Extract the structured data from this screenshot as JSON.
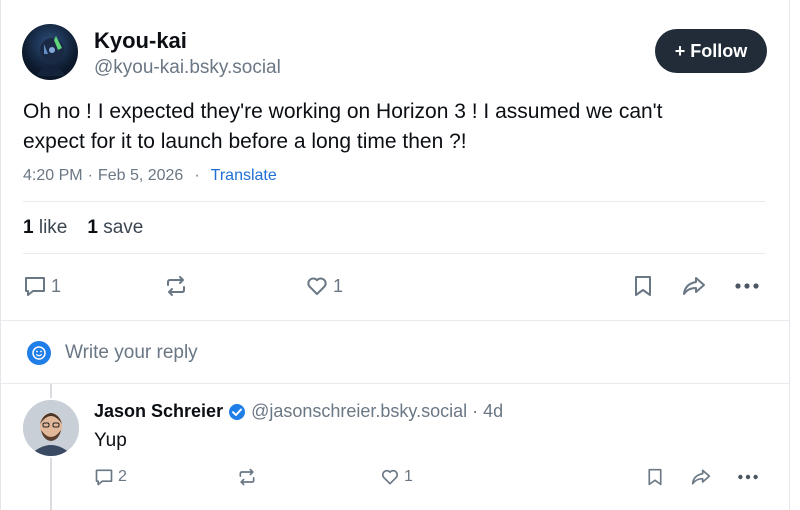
{
  "post": {
    "author_name": "Kyou-kai",
    "author_handle": "@kyou-kai.bsky.social",
    "follow_label": "+ Follow",
    "text_line1": "Oh no ! I expected they're working on Horizon 3 ! I assumed we can't",
    "text_line2": "expect for it to launch before a long time then ?!",
    "time": "4:20 PM",
    "date": "Feb 5, 2026",
    "dot": "·",
    "translate_label": "Translate",
    "likes_count": "1",
    "likes_label": "like",
    "saves_count": "1",
    "saves_label": "save",
    "actions": {
      "reply_count": "1",
      "like_count": "1"
    }
  },
  "composer": {
    "placeholder": "Write your reply"
  },
  "reply": {
    "author_name": "Jason Schreier",
    "author_handle": "@jasonschreier.bsky.social",
    "separator": "·",
    "age": "4d",
    "text": "Yup",
    "actions": {
      "reply_count": "2",
      "like_count": "1"
    }
  },
  "colors": {
    "accent": "#1f6fd6",
    "muted": "#6a7784",
    "follow_bg": "#222c38",
    "divider": "#e7eaee"
  }
}
